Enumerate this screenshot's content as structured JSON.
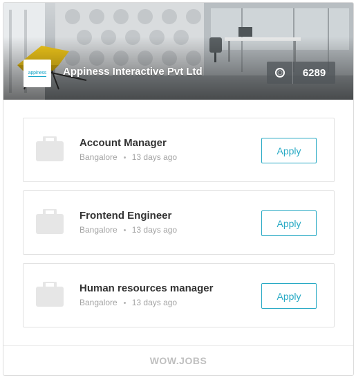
{
  "company": {
    "name": "Appiness Interactive Pvt Ltd",
    "logo_text": "appiness",
    "followers_count": "6289",
    "followers_icon": "circle-ring-icon"
  },
  "jobs": [
    {
      "title": "Account Manager",
      "location": "Bangalore",
      "posted": "13 days ago",
      "apply_label": "Apply"
    },
    {
      "title": "Frontend Engineer",
      "location": "Bangalore",
      "posted": "13 days ago",
      "apply_label": "Apply"
    },
    {
      "title": "Human resources manager",
      "location": "Bangalore",
      "posted": "13 days ago",
      "apply_label": "Apply"
    }
  ],
  "footer": {
    "brand": "WOW.JOBS"
  },
  "colors": {
    "accent": "#27a9c4",
    "title_text": "#333333",
    "meta_text": "#a3a3a3",
    "icon_gray": "#e6e6e6"
  }
}
